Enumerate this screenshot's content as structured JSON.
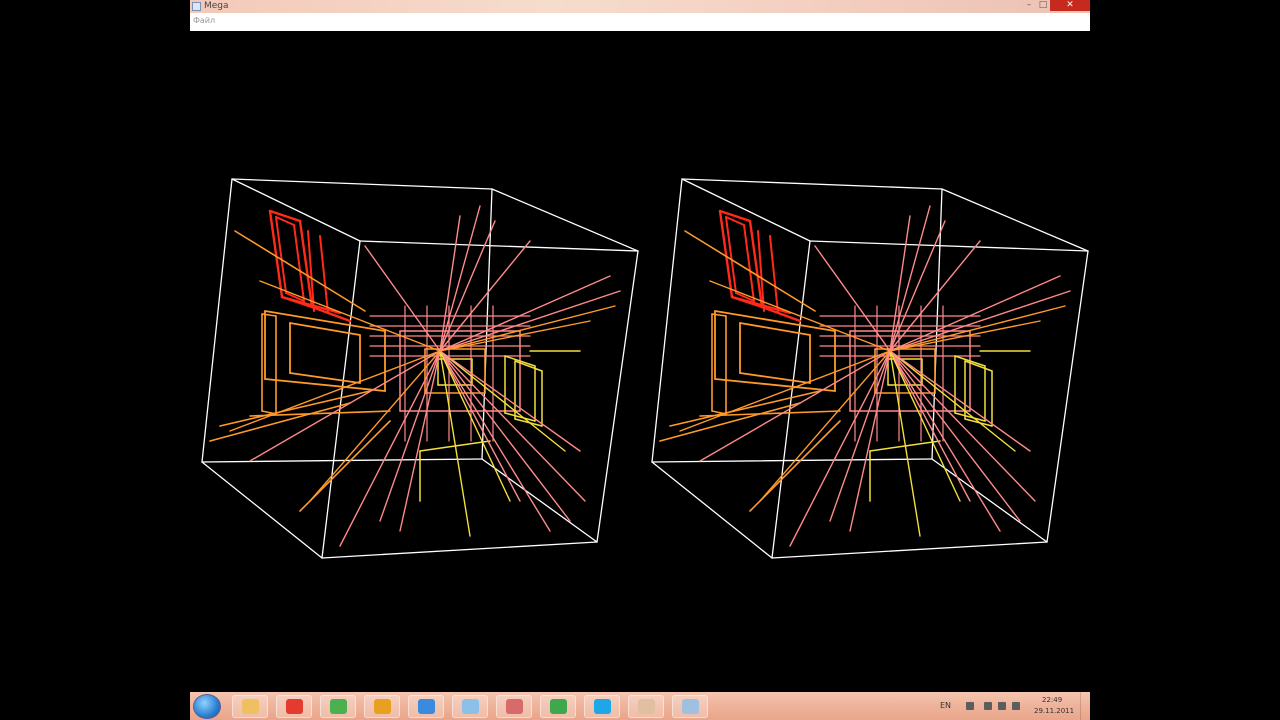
{
  "window": {
    "title": "Mega",
    "menu_label": "Файл",
    "minimize_glyph": "–",
    "maximize_glyph": "□",
    "close_glyph": "✕"
  },
  "scene": {
    "background": "#000000",
    "cube_edge_color": "#ffffff",
    "colors": {
      "red": "#ff2a1a",
      "orange": "#ff9a2a",
      "yellow": "#f2e03a",
      "pink": "#ff8a8a",
      "white": "#ffffff"
    }
  },
  "taskbar": {
    "start_icon": "windows-start-icon",
    "apps": [
      {
        "name": "windows-explorer-icon",
        "color": "#f0c060"
      },
      {
        "name": "chrome-icon",
        "color": "#e53b2e"
      },
      {
        "name": "utorrent-icon",
        "color": "#4caf50"
      },
      {
        "name": "media-player-icon",
        "color": "#e8a020"
      },
      {
        "name": "calculator-icon",
        "color": "#3a8be0"
      },
      {
        "name": "paint-icon",
        "color": "#8bc1e8"
      },
      {
        "name": "tool-icon",
        "color": "#d86a6a"
      },
      {
        "name": "utility-icon",
        "color": "#3fa84c"
      },
      {
        "name": "skype-icon",
        "color": "#1ea7e8"
      },
      {
        "name": "user-icon",
        "color": "#e0c0a0"
      },
      {
        "name": "shield-icon",
        "color": "#9fc0e0"
      }
    ],
    "language": "EN",
    "clock_time": "22:49",
    "clock_date": "29.11.2011"
  }
}
